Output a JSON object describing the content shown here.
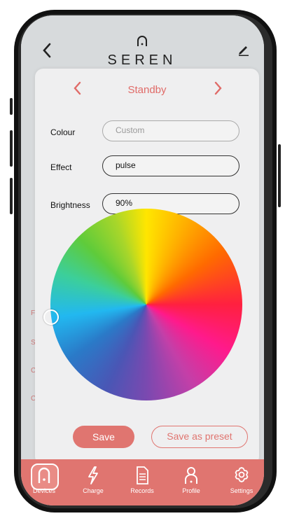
{
  "header": {
    "logo_text": "SEREN"
  },
  "modal": {
    "mode_title": "Standby",
    "rows": [
      {
        "label": "Colour",
        "value": "Custom",
        "state": "placeholder"
      },
      {
        "label": "Effect",
        "value": "pulse"
      },
      {
        "label": "Brightness",
        "value": "90%"
      }
    ],
    "save_label": "Save",
    "save_preset_label": "Save as preset"
  },
  "tabs": [
    {
      "label": "Devices",
      "icon": "device-icon",
      "active": true
    },
    {
      "label": "Charge",
      "icon": "lightning-icon"
    },
    {
      "label": "Records",
      "icon": "document-icon"
    },
    {
      "label": "Profile",
      "icon": "profile-icon"
    },
    {
      "label": "Settings",
      "icon": "gear-icon"
    }
  ],
  "colors": {
    "accent": "#e07570",
    "title_accent": "#e06b68"
  }
}
